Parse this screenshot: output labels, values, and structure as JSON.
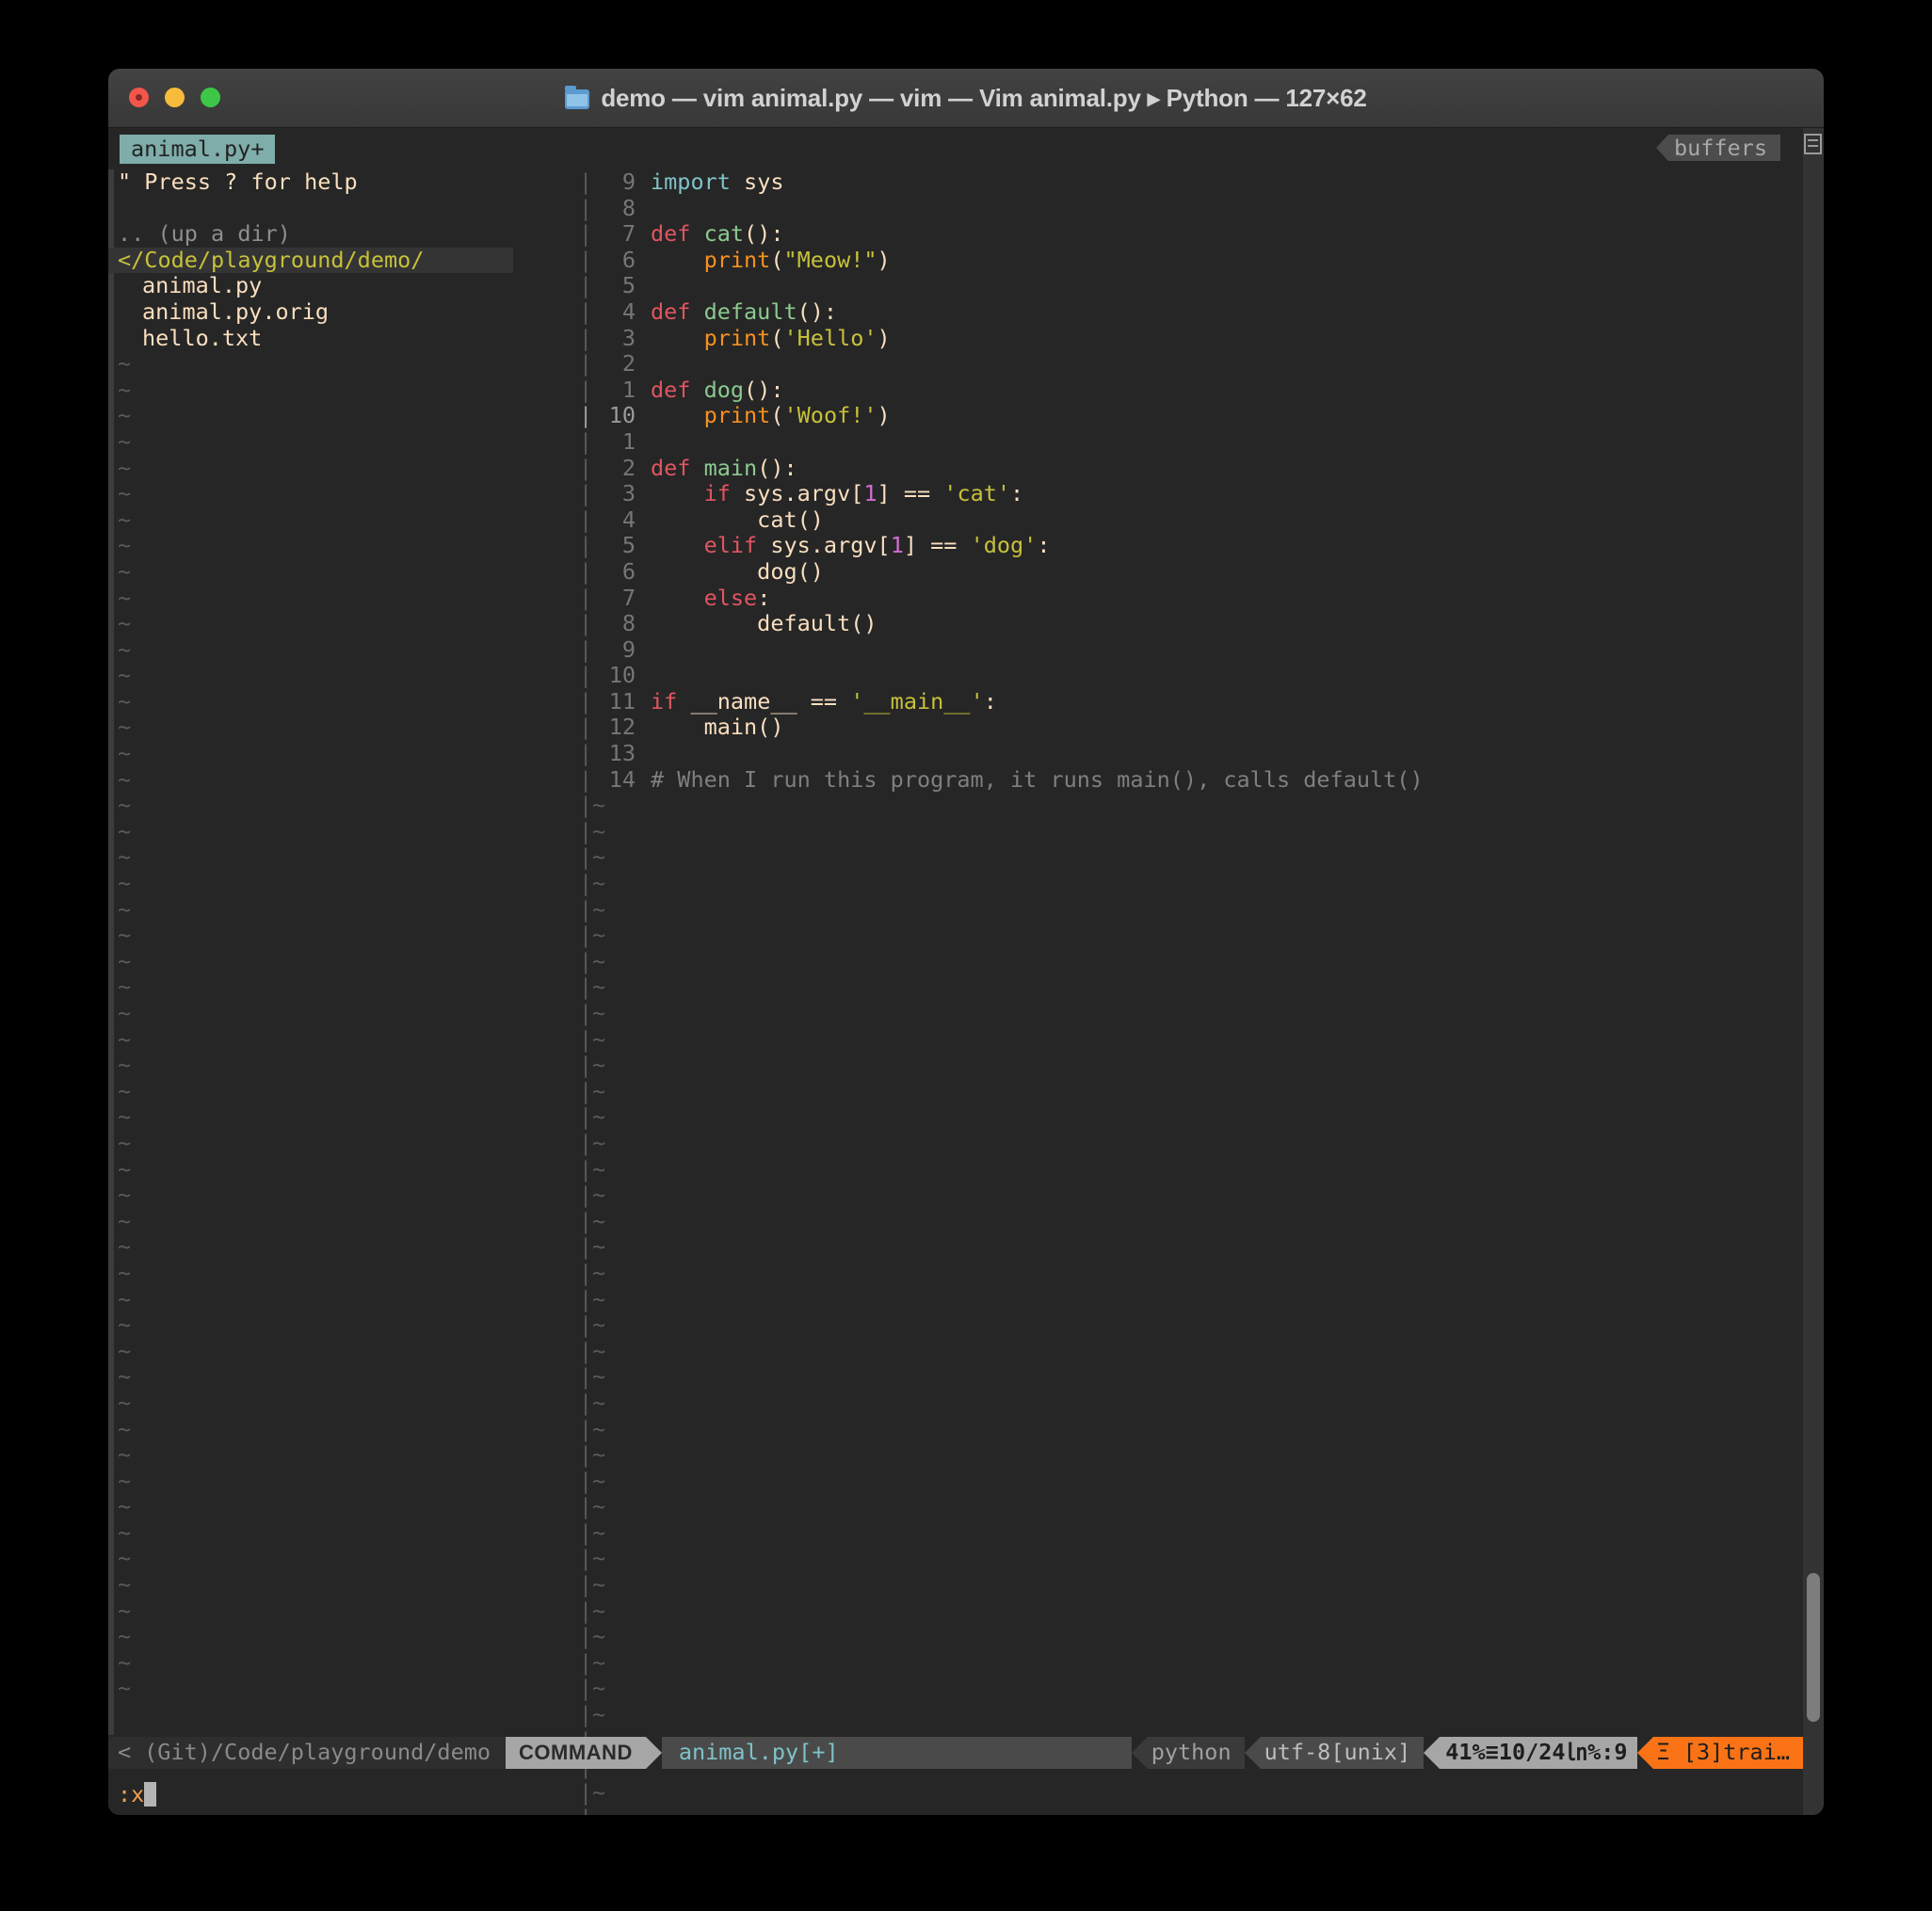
{
  "window": {
    "title": "demo — vim animal.py — vim — Vim animal.py ▸ Python — 127×62",
    "folder_icon": "folder-icon",
    "traffic_lights": [
      "close",
      "minimize",
      "maximize"
    ]
  },
  "tabline": {
    "active_tab": "animal.py+",
    "right_label": "buffers"
  },
  "tree": {
    "help": "\" Press ? for help",
    "up_dir": ".. (up a dir)",
    "current_dir": "</Code/playground/demo/",
    "files": [
      "animal.py",
      "animal.py.orig",
      "hello.txt"
    ],
    "tilde": "~",
    "tilde_rows": 52
  },
  "code": {
    "separator": "|",
    "tilde": "~",
    "tilde_rows": 42,
    "lines": [
      {
        "num": "9",
        "current": false,
        "tokens": [
          {
            "t": "import ",
            "c": "imp"
          },
          {
            "t": "sys",
            "c": "id"
          }
        ]
      },
      {
        "num": "8",
        "current": false,
        "tokens": []
      },
      {
        "num": "7",
        "current": false,
        "tokens": [
          {
            "t": "def ",
            "c": "kw"
          },
          {
            "t": "cat",
            "c": "fn"
          },
          {
            "t": "():",
            "c": "punct"
          }
        ]
      },
      {
        "num": "6",
        "current": false,
        "tokens": [
          {
            "t": "    ",
            "c": "id"
          },
          {
            "t": "print",
            "c": "bi"
          },
          {
            "t": "(",
            "c": "punct"
          },
          {
            "t": "\"Meow!\"",
            "c": "str"
          },
          {
            "t": ")",
            "c": "punct"
          }
        ]
      },
      {
        "num": "5",
        "current": false,
        "tokens": []
      },
      {
        "num": "4",
        "current": false,
        "tokens": [
          {
            "t": "def ",
            "c": "kw"
          },
          {
            "t": "default",
            "c": "fn"
          },
          {
            "t": "():",
            "c": "punct"
          }
        ]
      },
      {
        "num": "3",
        "current": false,
        "tokens": [
          {
            "t": "    ",
            "c": "id"
          },
          {
            "t": "print",
            "c": "bi"
          },
          {
            "t": "(",
            "c": "punct"
          },
          {
            "t": "'Hello'",
            "c": "str"
          },
          {
            "t": ")",
            "c": "punct"
          }
        ]
      },
      {
        "num": "2",
        "current": false,
        "tokens": []
      },
      {
        "num": "1",
        "current": false,
        "tokens": [
          {
            "t": "def ",
            "c": "kw"
          },
          {
            "t": "dog",
            "c": "fn"
          },
          {
            "t": "():",
            "c": "punct"
          }
        ]
      },
      {
        "num": "10",
        "current": true,
        "tokens": [
          {
            "t": "    ",
            "c": "id"
          },
          {
            "t": "print",
            "c": "bi"
          },
          {
            "t": "(",
            "c": "punct"
          },
          {
            "t": "'Woof!'",
            "c": "str"
          },
          {
            "t": ")",
            "c": "punct"
          }
        ]
      },
      {
        "num": "1",
        "current": false,
        "tokens": []
      },
      {
        "num": "2",
        "current": false,
        "tokens": [
          {
            "t": "def ",
            "c": "kw"
          },
          {
            "t": "main",
            "c": "fn"
          },
          {
            "t": "():",
            "c": "punct"
          }
        ]
      },
      {
        "num": "3",
        "current": false,
        "tokens": [
          {
            "t": "    ",
            "c": "id"
          },
          {
            "t": "if ",
            "c": "kw"
          },
          {
            "t": "sys.argv[",
            "c": "id"
          },
          {
            "t": "1",
            "c": "num"
          },
          {
            "t": "] == ",
            "c": "id"
          },
          {
            "t": "'cat'",
            "c": "str"
          },
          {
            "t": ":",
            "c": "punct"
          }
        ]
      },
      {
        "num": "4",
        "current": false,
        "tokens": [
          {
            "t": "        cat()",
            "c": "id"
          }
        ]
      },
      {
        "num": "5",
        "current": false,
        "tokens": [
          {
            "t": "    ",
            "c": "id"
          },
          {
            "t": "elif ",
            "c": "kw"
          },
          {
            "t": "sys.argv[",
            "c": "id"
          },
          {
            "t": "1",
            "c": "num"
          },
          {
            "t": "] == ",
            "c": "id"
          },
          {
            "t": "'dog'",
            "c": "str"
          },
          {
            "t": ":",
            "c": "punct"
          }
        ]
      },
      {
        "num": "6",
        "current": false,
        "tokens": [
          {
            "t": "        dog()",
            "c": "id"
          }
        ]
      },
      {
        "num": "7",
        "current": false,
        "tokens": [
          {
            "t": "    ",
            "c": "id"
          },
          {
            "t": "else",
            "c": "kw"
          },
          {
            "t": ":",
            "c": "punct"
          }
        ]
      },
      {
        "num": "8",
        "current": false,
        "tokens": [
          {
            "t": "        default()",
            "c": "id"
          }
        ]
      },
      {
        "num": "9",
        "current": false,
        "tokens": []
      },
      {
        "num": "10",
        "current": false,
        "tokens": []
      },
      {
        "num": "11",
        "current": false,
        "tokens": [
          {
            "t": "if ",
            "c": "kw"
          },
          {
            "t": "__name__",
            "c": "id"
          },
          {
            "t": " == ",
            "c": "id"
          },
          {
            "t": "'__main__'",
            "c": "str"
          },
          {
            "t": ":",
            "c": "punct"
          }
        ]
      },
      {
        "num": "12",
        "current": false,
        "tokens": [
          {
            "t": "    main()",
            "c": "id"
          }
        ]
      },
      {
        "num": "13",
        "current": false,
        "tokens": []
      },
      {
        "num": "14",
        "current": false,
        "tokens": [
          {
            "t": "# When I run this program, it runs main(), calls default()",
            "c": "com"
          }
        ]
      }
    ]
  },
  "statusline": {
    "git_prefix": "<",
    "git_path": "(Git)/Code/playground/demo",
    "mode": "COMMAND",
    "filename": "animal.py[+]",
    "filetype": "python",
    "encoding": "utf-8[unix]",
    "position": "41%≡10/24㏑%:9",
    "warning": "Ξ [3]trai…"
  },
  "cmdline": {
    "text": ":x"
  },
  "colors": {
    "background": "#262626",
    "tab_active_bg": "#7eadaa",
    "keyword": "#e05561",
    "function": "#8cc98f",
    "builtin": "#f79020",
    "string": "#c7c13a",
    "number": "#d06fd0",
    "import": "#7fc3c9",
    "comment": "#7f7f7f",
    "identifier": "#fadfbf",
    "dir_highlight": "#c7c13a",
    "warning": "#f97316",
    "mode_bg": "#a6a6a6"
  }
}
